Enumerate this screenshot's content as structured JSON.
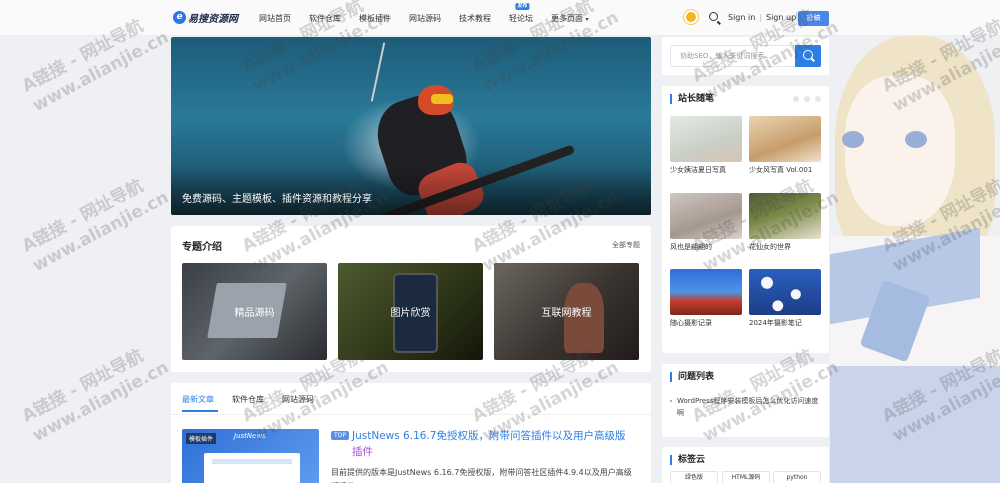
{
  "header": {
    "logo_text": "易搜资源网",
    "nav": [
      "网站首页",
      "软件仓库",
      "模板插件",
      "网站源码",
      "技术教程",
      "轻论坛",
      "更多页面"
    ],
    "nav_badge": "发布",
    "signin": "Sign in",
    "signup": "Sign up",
    "separator": "|",
    "post_label": "投稿"
  },
  "hero": {
    "caption": "免费源码、主题模板、插件资源和教程分享"
  },
  "topics": {
    "title": "专题介绍",
    "all_link": "全部专题",
    "tiles": [
      "精品源码",
      "图片欣赏",
      "互联网教程"
    ]
  },
  "articles": {
    "tabs": [
      "最新文章",
      "软件仓库",
      "网站源码"
    ],
    "thumb_tag": "模板插件",
    "thumb_brand": "JustNews",
    "top_tag": "TOP",
    "title": "JustNews 6.16.7免授权版，附带问答插件以及用户高级版",
    "title_tail": "插件",
    "desc": "目前提供的版本是JustNews 6.16.7免授权版，附带问答社区插件4.9.4以及用户高级版插件"
  },
  "sidebar": {
    "search_placeholder": "协助SEO，输入关键词搜索...",
    "photos_title": "站长随笔",
    "photos": [
      "少女姨洁夏日写真",
      "少女风写真 Vol.001",
      "风也是翩翩的",
      "花仙女的世界",
      "随心摄影记录",
      "2024年摄影笔记"
    ],
    "qa_title": "问题列表",
    "qa_item": "WordPress程序安装模板后怎么优化访问速度啊",
    "tags_title": "标签云",
    "tags": [
      "绿色版",
      "HTML源码",
      "python"
    ]
  },
  "watermark": {
    "line1": "A链接 - 网址导航",
    "line2": "www.alianjie.cn"
  },
  "colors": {
    "accent": "#2d7fe6",
    "post_button": "#4a86e8",
    "title_tail": "#a050d0"
  }
}
